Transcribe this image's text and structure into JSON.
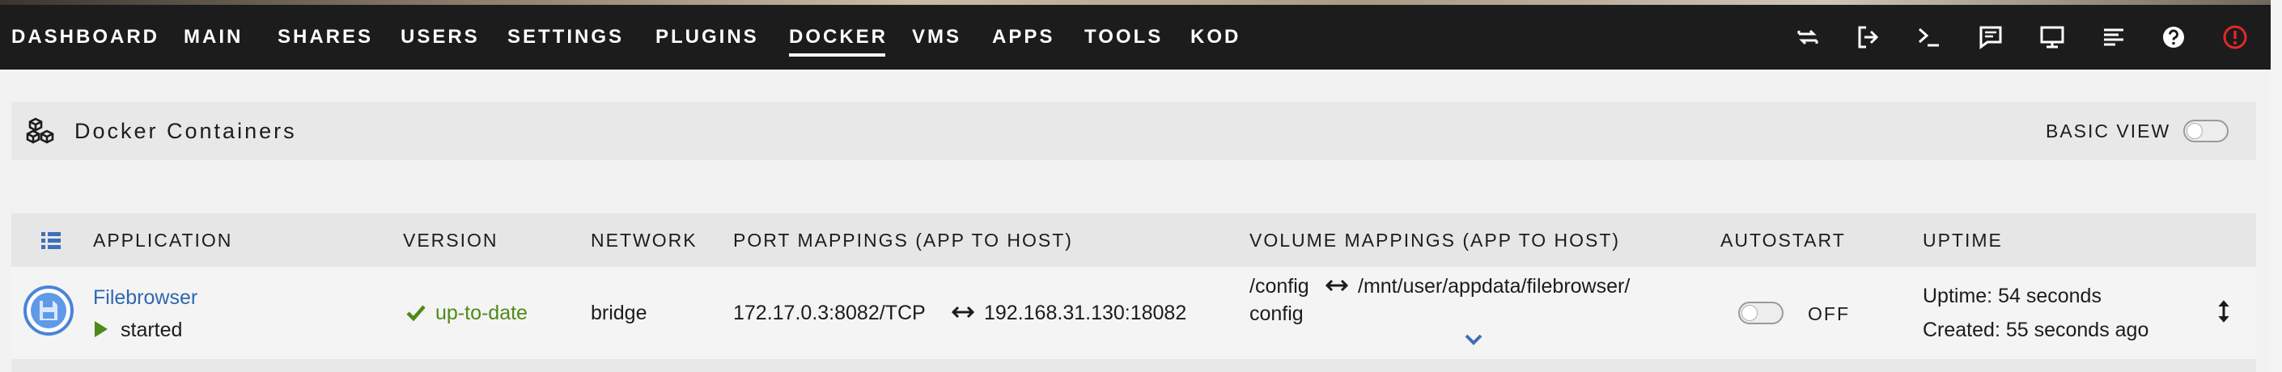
{
  "nav": {
    "items": [
      "DASHBOARD",
      "MAIN",
      "SHARES",
      "USERS",
      "SETTINGS",
      "PLUGINS",
      "DOCKER",
      "VMS",
      "APPS",
      "TOOLS",
      "KOD"
    ],
    "active": "DOCKER",
    "icons": [
      "refresh-icon",
      "logout-icon",
      "terminal-icon",
      "feedback-icon",
      "monitor-icon",
      "log-icon",
      "help-icon",
      "notification-alert-icon"
    ],
    "alert_color": "#e22828"
  },
  "panel": {
    "title": "Docker Containers",
    "basic_view_label": "BASIC VIEW",
    "basic_view_on": false
  },
  "table": {
    "headers": [
      "APPLICATION",
      "VERSION",
      "NETWORK",
      "PORT MAPPINGS (APP TO HOST)",
      "VOLUME MAPPINGS (APP TO HOST)",
      "AUTOSTART",
      "UPTIME"
    ],
    "rows": [
      {
        "app_name": "Filebrowser",
        "status": "started",
        "version": "up-to-date",
        "network": "bridge",
        "port_app": "172.17.0.3:8082/TCP",
        "port_host": "192.168.31.130:18082",
        "volume_app": "/config",
        "volume_host_line1": "/mnt/user/appdata/filebrowser/",
        "volume_host_line2": "config",
        "autostart_label": "OFF",
        "autostart_on": false,
        "uptime": "Uptime: 54 seconds",
        "created": "Created: 55 seconds ago"
      }
    ]
  },
  "colors": {
    "link": "#2e67b1",
    "status_green": "#4e8a17",
    "navbar_bg": "#1c1c1c"
  }
}
